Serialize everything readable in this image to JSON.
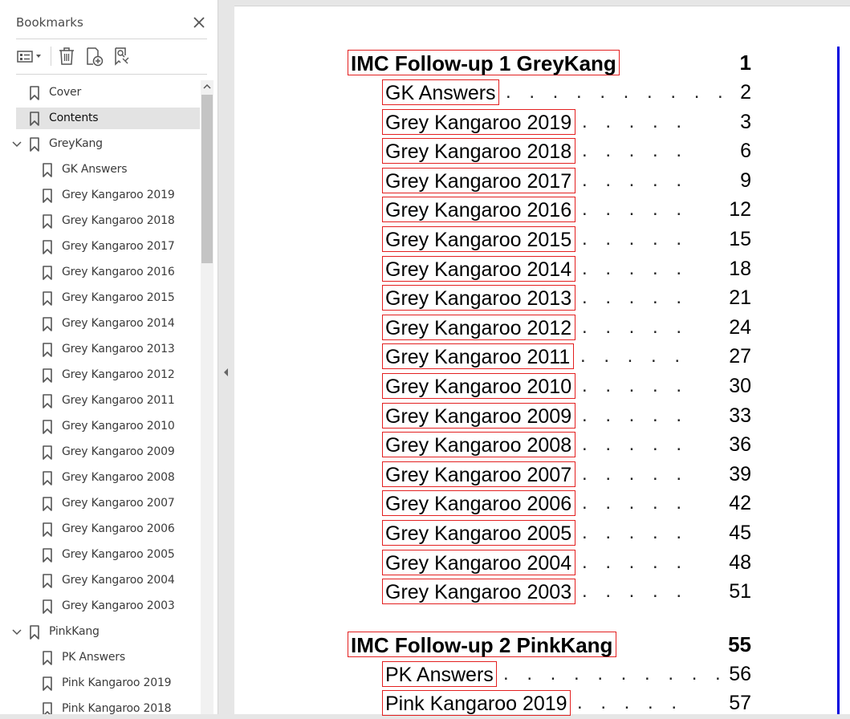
{
  "panel": {
    "title": "Bookmarks",
    "toolbar": {
      "options_icon": "list-options-icon",
      "delete_icon": "trash-icon",
      "new_bookmark_icon": "add-bookmark-icon",
      "from_structure_icon": "bookmark-search-icon"
    },
    "bookmarks": [
      {
        "label": "Cover",
        "level": 0,
        "expandable": false,
        "selected": false
      },
      {
        "label": "Contents",
        "level": 0,
        "expandable": false,
        "selected": true
      },
      {
        "label": "GreyKang",
        "level": 0,
        "expandable": true,
        "expanded": true,
        "selected": false
      },
      {
        "label": "GK Answers",
        "level": 1
      },
      {
        "label": "Grey Kangaroo 2019",
        "level": 1
      },
      {
        "label": "Grey Kangaroo 2018",
        "level": 1
      },
      {
        "label": "Grey Kangaroo 2017",
        "level": 1
      },
      {
        "label": "Grey Kangaroo 2016",
        "level": 1
      },
      {
        "label": "Grey Kangaroo 2015",
        "level": 1
      },
      {
        "label": "Grey Kangaroo 2014",
        "level": 1
      },
      {
        "label": "Grey Kangaroo 2013",
        "level": 1
      },
      {
        "label": "Grey Kangaroo 2012",
        "level": 1
      },
      {
        "label": "Grey Kangaroo 2011",
        "level": 1
      },
      {
        "label": "Grey Kangaroo 2010",
        "level": 1
      },
      {
        "label": "Grey Kangaroo 2009",
        "level": 1
      },
      {
        "label": "Grey Kangaroo 2008",
        "level": 1
      },
      {
        "label": "Grey Kangaroo 2007",
        "level": 1
      },
      {
        "label": "Grey Kangaroo 2006",
        "level": 1
      },
      {
        "label": "Grey Kangaroo 2005",
        "level": 1
      },
      {
        "label": "Grey Kangaroo 2004",
        "level": 1
      },
      {
        "label": "Grey Kangaroo 2003",
        "level": 1
      },
      {
        "label": "PinkKang",
        "level": 0,
        "expandable": true,
        "expanded": true,
        "selected": false
      },
      {
        "label": "PK Answers",
        "level": 1
      },
      {
        "label": "Pink Kangaroo 2019",
        "level": 1
      },
      {
        "label": "Pink Kangaroo 2018",
        "level": 1
      }
    ]
  },
  "document": {
    "link_border_color": "#e32020",
    "rule_color": "#0000dd",
    "toc": [
      {
        "title": "IMC Follow-up 1  GreyKang",
        "page": "1",
        "kind": "chapter"
      },
      {
        "title": "GK Answers",
        "page": "2",
        "kind": "section",
        "dots": ". . . . . . . . . ."
      },
      {
        "title": "Grey Kangaroo 2019",
        "page": "3",
        "kind": "section",
        "dots": ". . . . ."
      },
      {
        "title": "Grey Kangaroo 2018",
        "page": "6",
        "kind": "section",
        "dots": ". . . . ."
      },
      {
        "title": "Grey Kangaroo 2017",
        "page": "9",
        "kind": "section",
        "dots": ". . . . ."
      },
      {
        "title": "Grey Kangaroo 2016",
        "page": "12",
        "kind": "section",
        "dots": ". . . . ."
      },
      {
        "title": "Grey Kangaroo 2015",
        "page": "15",
        "kind": "section",
        "dots": ". . . . ."
      },
      {
        "title": "Grey Kangaroo 2014",
        "page": "18",
        "kind": "section",
        "dots": ". . . . ."
      },
      {
        "title": "Grey Kangaroo 2013",
        "page": "21",
        "kind": "section",
        "dots": ". . . . ."
      },
      {
        "title": "Grey Kangaroo 2012",
        "page": "24",
        "kind": "section",
        "dots": ". . . . ."
      },
      {
        "title": "Grey Kangaroo 2011",
        "page": "27",
        "kind": "section",
        "dots": ". . . . ."
      },
      {
        "title": "Grey Kangaroo 2010",
        "page": "30",
        "kind": "section",
        "dots": ". . . . ."
      },
      {
        "title": "Grey Kangaroo 2009",
        "page": "33",
        "kind": "section",
        "dots": ". . . . ."
      },
      {
        "title": "Grey Kangaroo 2008",
        "page": "36",
        "kind": "section",
        "dots": ". . . . ."
      },
      {
        "title": "Grey Kangaroo 2007",
        "page": "39",
        "kind": "section",
        "dots": ". . . . ."
      },
      {
        "title": "Grey Kangaroo 2006",
        "page": "42",
        "kind": "section",
        "dots": ". . . . ."
      },
      {
        "title": "Grey Kangaroo 2005",
        "page": "45",
        "kind": "section",
        "dots": ". . . . ."
      },
      {
        "title": "Grey Kangaroo 2004",
        "page": "48",
        "kind": "section",
        "dots": ". . . . ."
      },
      {
        "title": "Grey Kangaroo 2003",
        "page": "51",
        "kind": "section",
        "dots": ". . . . ."
      },
      {
        "title": "IMC Follow-up 2  PinkKang",
        "page": "55",
        "kind": "chapter"
      },
      {
        "title": "PK Answers",
        "page": "56",
        "kind": "section",
        "dots": ". . . . . . . . . ."
      },
      {
        "title": "Pink Kangaroo 2019",
        "page": "57",
        "kind": "section",
        "dots": ". . . . ."
      }
    ]
  }
}
